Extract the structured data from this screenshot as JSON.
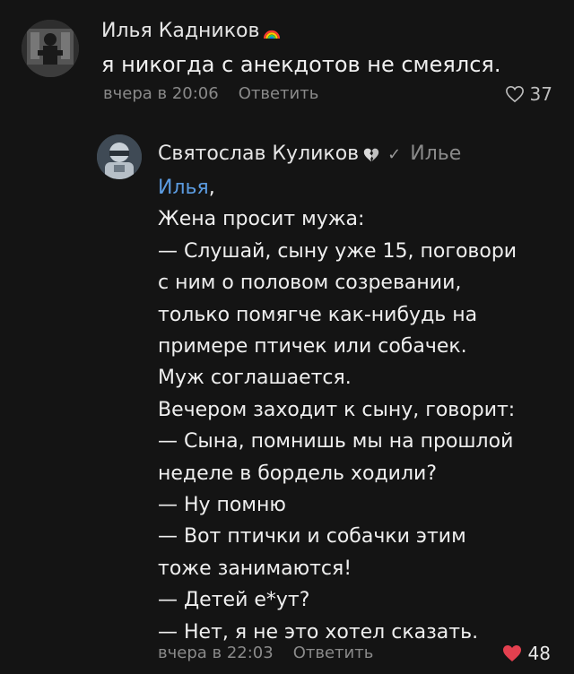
{
  "comment1": {
    "author": "Илья Кадников",
    "text": "я никогда с анекдотов не смеялся.",
    "time": "вчера в 20:06",
    "reply_label": "Ответить",
    "likes": "37"
  },
  "comment2": {
    "author": "Святослав Куликов",
    "reply_to": "Илье",
    "mention": "Илья",
    "mention_suffix": ",",
    "lines": [
      "Жена просит мужа:",
      "— Слушай, сыну уже 15, поговори",
      "с ним о половом созревании,",
      "только помягче как-нибудь на",
      "примере птичек или собачек.",
      "Муж соглашается.",
      "Вечером заходит к сыну, говорит:",
      "— Сына, помнишь мы на прошлой",
      "неделе в бордель ходили?",
      "— Ну помню",
      "— Вот птички и собачки этим",
      "тоже занимаются!",
      "— Детей е*ут?",
      "— Нет, я не это хотел сказать."
    ],
    "time": "вчера в 22:03",
    "reply_label": "Ответить",
    "likes": "48"
  },
  "colors": {
    "background": "#141414",
    "mention": "#5b9be0",
    "liked_heart": "#e3404f",
    "muted": "#8a8a8a"
  },
  "icons": {
    "comment1_badge": "rainbow-icon",
    "comment2_badge": "broken-heart-icon",
    "comment2_status": "checkmark-icon",
    "comment1_like": "heart-outline-icon",
    "comment2_like": "heart-filled-icon"
  }
}
